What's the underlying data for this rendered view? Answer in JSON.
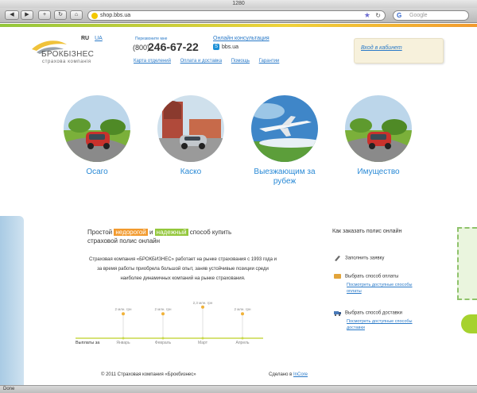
{
  "browser": {
    "window_title": "1280",
    "url": "shop.bbs.ua",
    "search_placeholder": "Google",
    "status": "Done"
  },
  "header": {
    "logo_name": "БРОКБІЗНЕС",
    "logo_sub": "страхова компанія",
    "lang_current": "RU",
    "lang_other": "UA",
    "call_label": "Перезвоните мне",
    "phone_prefix": "(800)",
    "phone_number": "246-67-22",
    "consult_link": "Онлайн консультация",
    "skype": "bbs.ua",
    "nav": [
      "Карта отделений",
      "Оплата и доставка",
      "Помощь",
      "Гарантии"
    ],
    "login": "Вход в кабинет"
  },
  "products": [
    {
      "label": "Осаго"
    },
    {
      "label": "Каско"
    },
    {
      "label": "Выезжающим за рубеж"
    },
    {
      "label": "Имущество"
    }
  ],
  "tagline": {
    "part1": "Простой ",
    "orange": "недорогой",
    "part2": " и ",
    "green": "надежный",
    "part3": " способ купить страховой полис онлайн"
  },
  "about": "Страховая компания «БРОКБИЗНЕС» работает на рынке страхования с 1993 года и за время работы приобрела большой опыт, заняв устойчивые позиции среди наиболее динамичных компаний на рынке страхования.",
  "chart_data": {
    "type": "line",
    "title": "",
    "xlabel": "Выплаты за",
    "categories": [
      "Январь",
      "Февраль",
      "Март",
      "Апрель"
    ],
    "value_labels": [
      "2 млн. грн",
      "2 млн. грн",
      "2,3 млн. грн",
      "2 млн. грн"
    ],
    "values": [
      2,
      2,
      2.3,
      2
    ]
  },
  "how_to": {
    "title": "Как заказать полис онлайн",
    "steps": [
      {
        "label": "Заполнить заявку",
        "icon": "pen-icon"
      },
      {
        "label": "Выбрать способ оплаты",
        "icon": "wallet-icon",
        "link": "Посмотреть доступные способы оплаты"
      },
      {
        "label": "Выбрать способ доставки",
        "icon": "truck-icon",
        "link": "Посмотреть доступные способы доставки"
      }
    ]
  },
  "footer": {
    "copyright": "© 2011 Страховая компания «Брокбизнес»",
    "made_prefix": "Сделано в ",
    "made_link": "InCore"
  }
}
